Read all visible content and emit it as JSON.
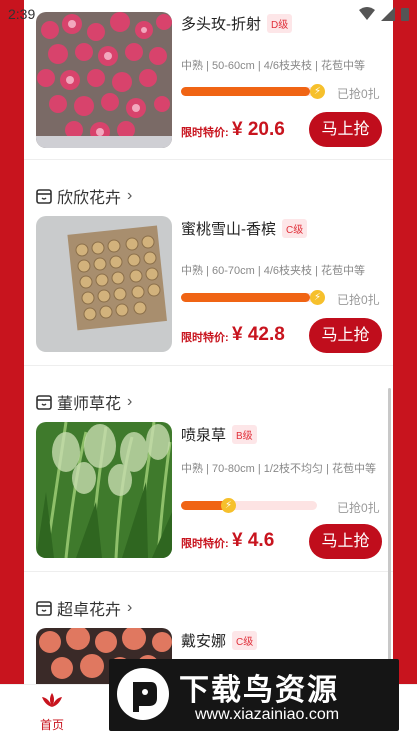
{
  "status_bar": {
    "time": "2:39"
  },
  "products": [
    {
      "shop": "",
      "name": "多头玫-折射",
      "grade": "D级",
      "spec": "中熟 | 50-60cm | 4/6枝夹枝 | 花苞中等",
      "progress": 0.95,
      "sold": "已抢0扎",
      "price_label": "限时特价:",
      "price": "¥ 20.6",
      "buy_label": "马上抢"
    },
    {
      "shop": "欣欣花卉",
      "name": "蜜桃雪山-香槟",
      "grade": "C级",
      "spec": "中熟 | 60-70cm | 4/6枝夹枝 | 花苞中等",
      "progress": 0.95,
      "sold": "已抢0扎",
      "price_label": "限时特价:",
      "price": "¥ 42.8",
      "buy_label": "马上抢"
    },
    {
      "shop": "董师草花",
      "name": "喷泉草",
      "grade": "B级",
      "spec": "中熟 | 70-80cm | 1/2枝不均匀 | 花苞中等",
      "progress": 0.35,
      "sold": "已抢0扎",
      "price_label": "限时特价:",
      "price": "¥ 4.6",
      "buy_label": "马上抢"
    },
    {
      "shop": "超卓花卉",
      "name": "戴安娜",
      "grade": "C级"
    }
  ],
  "bottom_nav": {
    "home_label": "首页"
  },
  "watermark": {
    "title": "下载鸟资源",
    "url": "www.xiazainiao.com"
  },
  "colors": {
    "brand_red": "#c8141e",
    "progress_orange": "#f06414"
  }
}
